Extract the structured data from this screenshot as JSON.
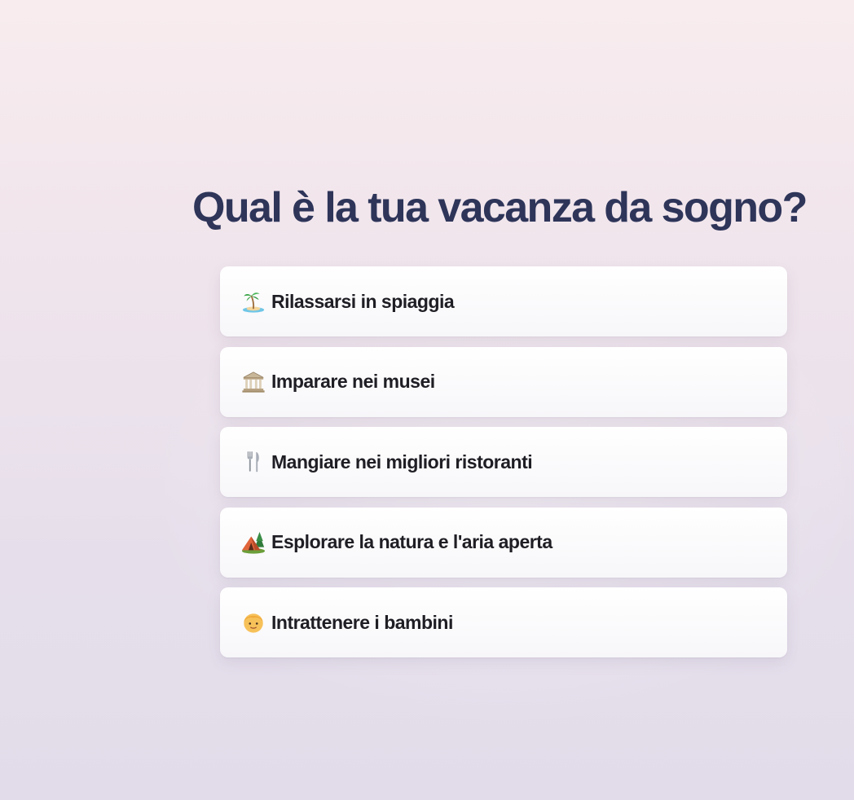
{
  "quiz": {
    "question": "Qual è la tua vacanza da sogno?",
    "options": [
      {
        "icon": "desert-island-icon",
        "emoji": "🏝️",
        "label": "Rilassarsi in spiaggia"
      },
      {
        "icon": "classical-building-icon",
        "emoji": "🏛️",
        "label": "Imparare nei musei"
      },
      {
        "icon": "fork-and-knife-icon",
        "emoji": "🍴",
        "label": "Mangiare nei migliori ristoranti"
      },
      {
        "icon": "camping-tent-icon",
        "emoji": "🏕️",
        "label": "Esplorare la natura e l'aria aperta"
      },
      {
        "icon": "child-face-icon",
        "emoji": "🧒",
        "label": "Intrattenere i bambini"
      }
    ]
  },
  "colors": {
    "question_text": "#2e3559",
    "option_text": "#1e1e24",
    "option_background": "#ffffff",
    "page_background_top": "#f8ecee",
    "page_background_bottom": "#e2dcea"
  }
}
